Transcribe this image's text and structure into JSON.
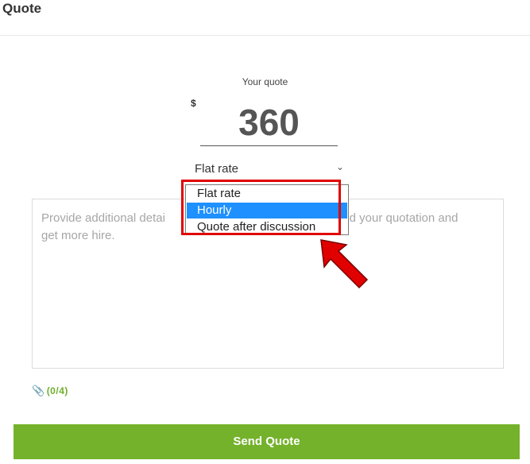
{
  "header": {
    "title": "Quote"
  },
  "quote": {
    "label": "Your quote",
    "currency": "$",
    "amount": "360"
  },
  "rate": {
    "selected": "Flat rate",
    "options": [
      "Flat rate",
      "Hourly",
      "Quote after discussion"
    ],
    "highlighted": "Hourly"
  },
  "details": {
    "placeholder_start": "Provide additional detai",
    "placeholder_end": "and your quotation and",
    "placeholder_line2": "get more hire."
  },
  "attachments": {
    "count": "(0/4)"
  },
  "actions": {
    "send_label": "Send Quote"
  },
  "colors": {
    "accent": "#74b22b",
    "highlight_border": "#e00000",
    "option_selected": "#1e90ff"
  },
  "icons": {
    "chevron": "chevron-down-icon",
    "attach": "paperclip-icon",
    "pointer": "red-arrow-annotation"
  }
}
